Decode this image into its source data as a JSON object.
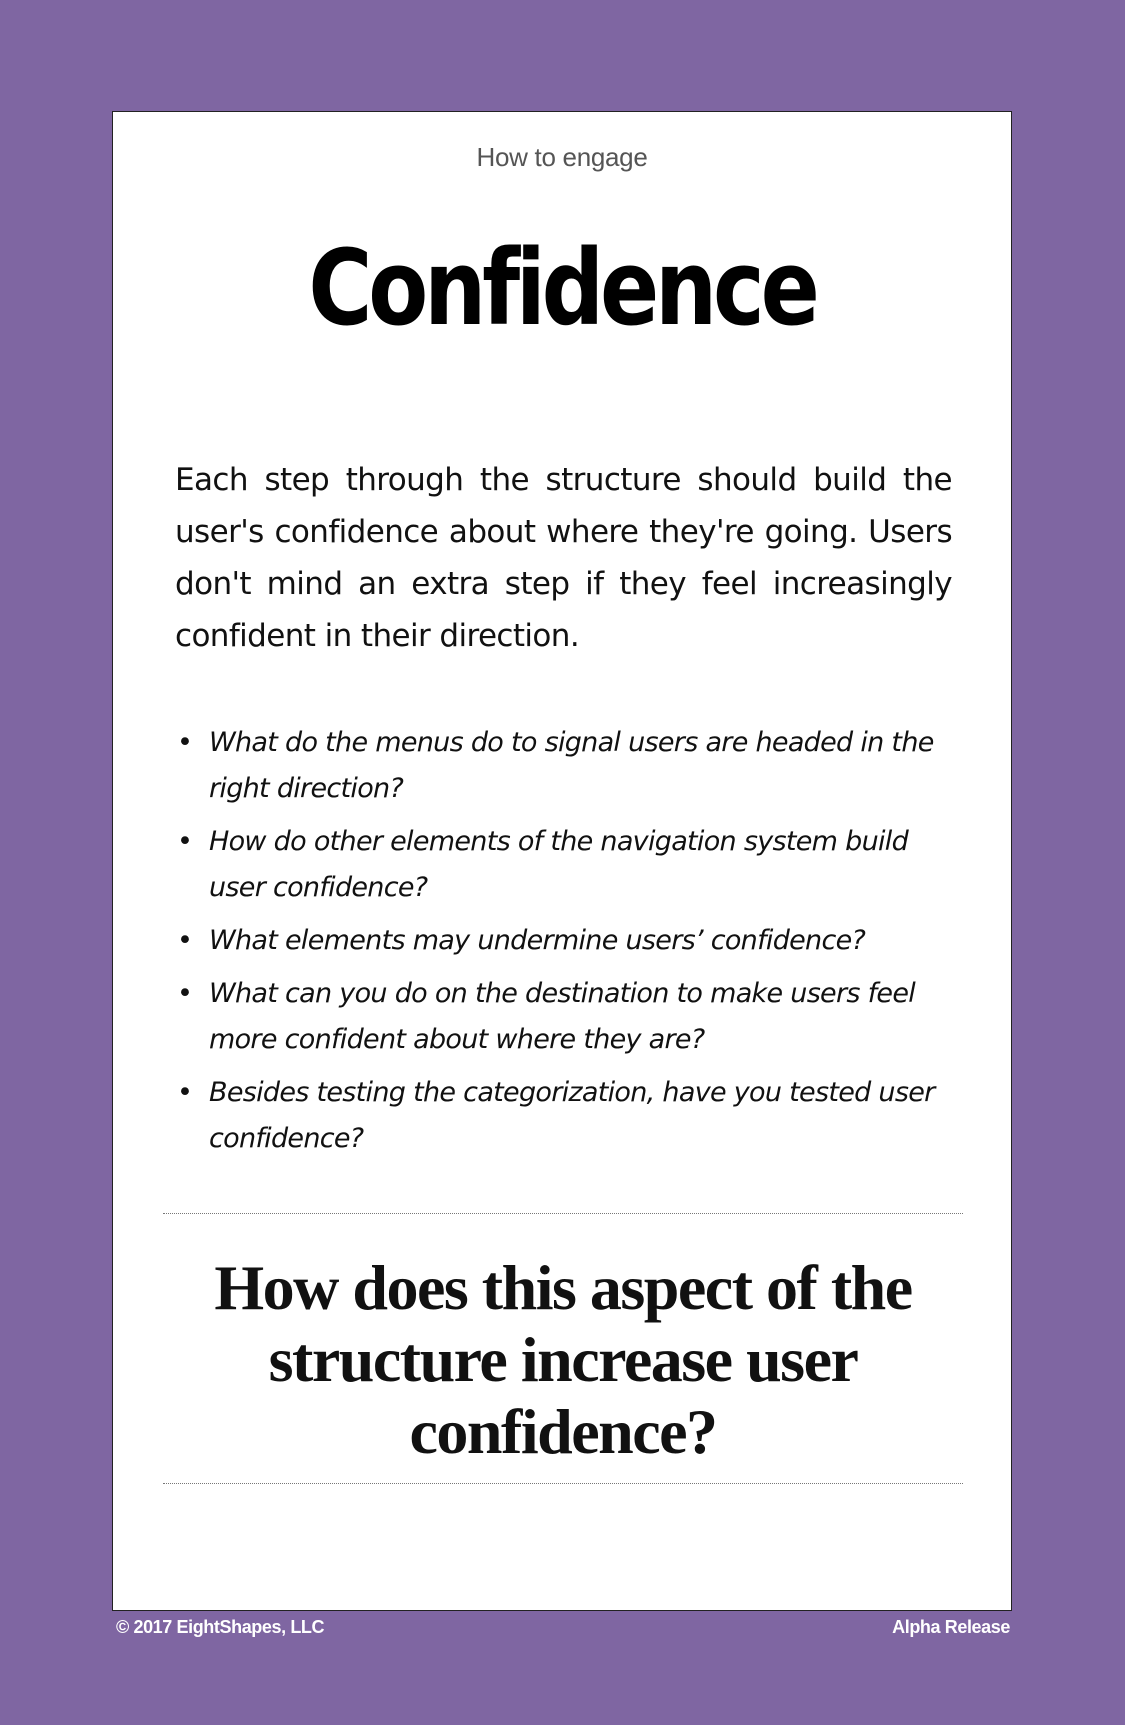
{
  "card": {
    "eyebrow": "How to engage",
    "title": "Confidence",
    "intro": "Each step through the structure should build the user's confidence about where they're going. Users don't mind an extra step if they feel increasingly confident in their direction.",
    "questions": [
      "What do the menus do to signal users are headed in the right direction?",
      "How do other elements of the navigation system build user confidence?",
      "What elements may undermine users’ confidence?",
      "What can you do on the destination to make users feel more confident about where they are?",
      "Besides testing the categorization, have you tested user confidence?"
    ],
    "prompt": "How does this aspect of the structure increase user confidence?"
  },
  "footer": {
    "copyright": "© 2017 EightShapes, LLC",
    "release": "Alpha Release"
  },
  "colors": {
    "background": "#7f66a2",
    "card": "#ffffff"
  }
}
